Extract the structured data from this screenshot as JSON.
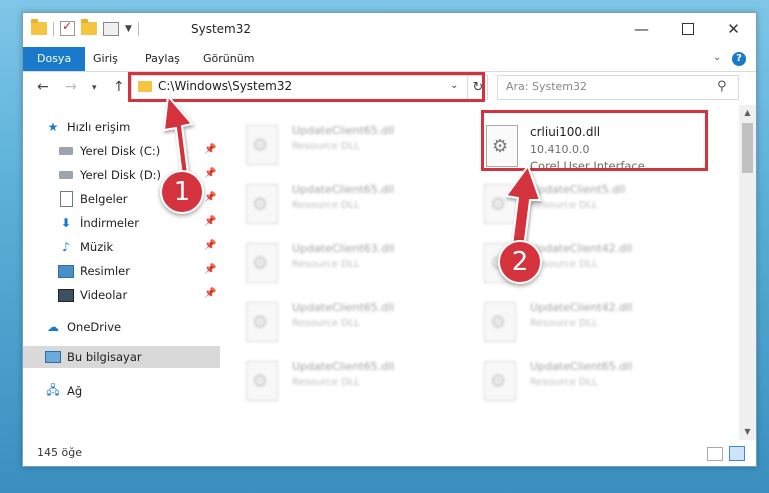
{
  "window": {
    "title": "System32"
  },
  "ribbon": {
    "tabs": [
      "Dosya",
      "Giriş",
      "Paylaş",
      "Görünüm"
    ]
  },
  "navigation": {
    "address": "C:\\Windows\\System32",
    "search_placeholder": "Ara: System32"
  },
  "sidebar": {
    "items": [
      {
        "label": "Hızlı erişim",
        "icon": "star-icon",
        "pinned": false
      },
      {
        "label": "Yerel Disk (C:)",
        "icon": "disk-icon",
        "pinned": true
      },
      {
        "label": "Yerel Disk (D:)",
        "icon": "disk-icon",
        "pinned": true
      },
      {
        "label": "Belgeler",
        "icon": "document-icon",
        "pinned": true
      },
      {
        "label": "İndirmeler",
        "icon": "download-icon",
        "pinned": true
      },
      {
        "label": "Müzik",
        "icon": "music-icon",
        "pinned": true
      },
      {
        "label": "Resimler",
        "icon": "pictures-icon",
        "pinned": true
      },
      {
        "label": "Videolar",
        "icon": "video-icon",
        "pinned": true
      },
      {
        "label": "OneDrive",
        "icon": "cloud-icon",
        "pinned": false
      },
      {
        "label": "Bu bilgisayar",
        "icon": "computer-icon",
        "pinned": false,
        "selected": true
      },
      {
        "label": "Ağ",
        "icon": "network-icon",
        "pinned": false
      }
    ]
  },
  "files": {
    "highlighted": {
      "name": "crliui100.dll",
      "version": "10.410.0.0",
      "description": "Corel User Interface"
    },
    "blurred": [
      {
        "name": "UpdateClient65.dll",
        "type": "Resource DLL"
      },
      {
        "name": "UpdateClient65.dll",
        "type": "Resource DLL"
      },
      {
        "name": "UpdateClient5.dll",
        "type": "Resource DLL"
      },
      {
        "name": "UpdateClient63.dll",
        "type": "Resource DLL"
      },
      {
        "name": "UpdateClient42.dll",
        "type": "Resource DLL"
      },
      {
        "name": "UpdateClient65.dll",
        "type": "Resource DLL"
      },
      {
        "name": "UpdateClient42.dll",
        "type": "Resource DLL"
      },
      {
        "name": "UpdateClient65.dll",
        "type": "Resource DLL"
      },
      {
        "name": "UpdateClient65.dll",
        "type": "Resource DLL"
      }
    ]
  },
  "status": {
    "item_count": "145 öğe"
  },
  "annotations": {
    "step1": "1",
    "step2": "2",
    "highlight_color": "#d4333d"
  },
  "colors": {
    "accent": "#1979ca"
  }
}
